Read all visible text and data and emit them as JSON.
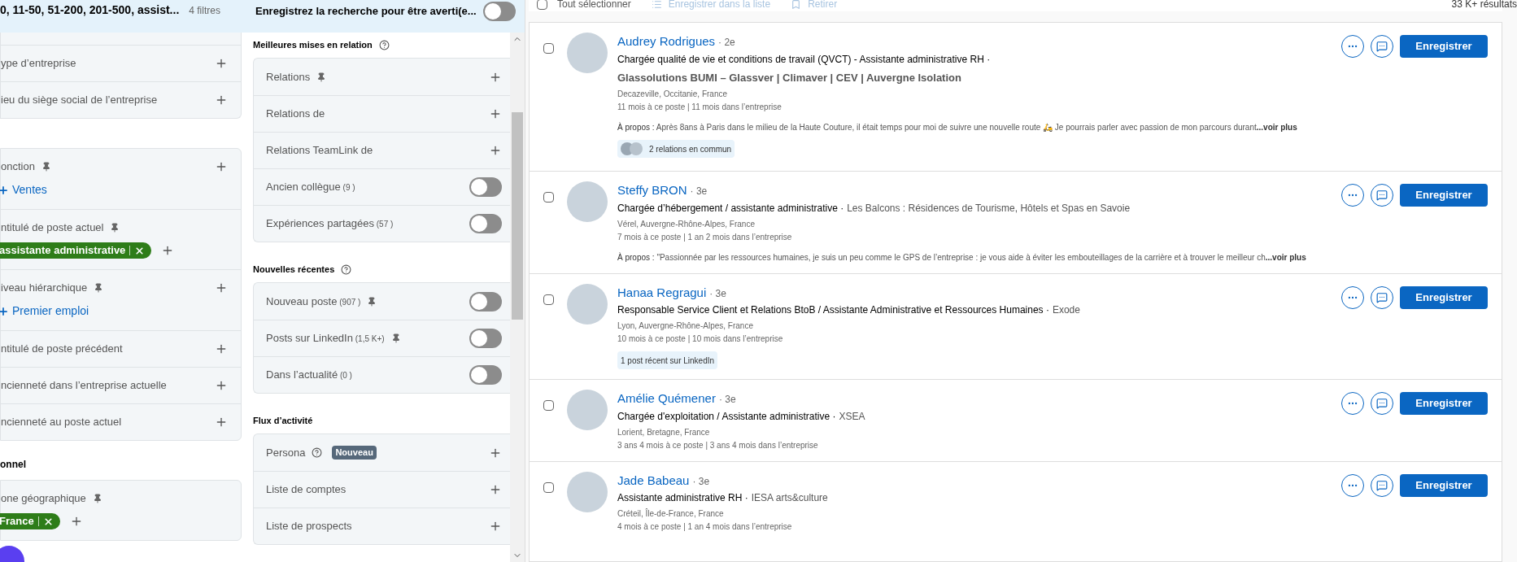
{
  "header": {
    "summary": "0, 11-50, 51-200, 201-500, assist...",
    "filter_count": "4 filtres",
    "save_search_label": "Enregistrez la recherche pour être averti(e...",
    "save_search_on": false
  },
  "left_groups": [
    {
      "cut_top": true,
      "items": [
        {
          "label": "ype d’entreprise"
        },
        {
          "label": "ieu du siège social de l’entreprise"
        }
      ]
    },
    {
      "items": [
        {
          "label": "onction",
          "pinned": true,
          "chips": [
            {
              "kind": "suggestion",
              "label": "Ventes"
            }
          ]
        },
        {
          "label": "ntitulé de poste actuel",
          "pinned": true,
          "chips": [
            {
              "kind": "included",
              "label": "assistante administrative"
            }
          ]
        },
        {
          "label": "iveau hiérarchique",
          "pinned": true,
          "chips": [
            {
              "kind": "suggestion",
              "label": "Premier emploi"
            }
          ]
        },
        {
          "label": "ntitulé de poste précédent"
        },
        {
          "label": "ncienneté dans l’entreprise actuelle"
        },
        {
          "label": "ncienneté au poste actuel"
        }
      ]
    },
    {
      "heading": "onnel",
      "items": [
        {
          "label": "one géographique",
          "pinned": true,
          "chips": [
            {
              "kind": "included",
              "label": "France"
            }
          ]
        }
      ]
    }
  ],
  "middle_groups": [
    {
      "heading": "Meilleures mises en relation",
      "help": true,
      "items": [
        {
          "kind": "add",
          "label": "Relations",
          "pinned": true
        },
        {
          "kind": "add",
          "label": "Relations de"
        },
        {
          "kind": "add",
          "label": "Relations TeamLink de"
        },
        {
          "kind": "toggle",
          "label": "Ancien collègue",
          "count": "(9 )",
          "on": false
        },
        {
          "kind": "toggle",
          "label": "Expériences partagées",
          "count": "(57 )",
          "on": false
        }
      ]
    },
    {
      "heading": "Nouvelles récentes",
      "help": true,
      "items": [
        {
          "kind": "toggle",
          "label": "Nouveau poste",
          "count": "(907 )",
          "pinned": true,
          "on": false
        },
        {
          "kind": "toggle",
          "label": "Posts sur LinkedIn",
          "count": "(1,5 K+)",
          "pinned": true,
          "on": false
        },
        {
          "kind": "toggle",
          "label": "Dans l’actualité",
          "count": "(0 )",
          "on": false
        }
      ]
    },
    {
      "heading": "Flux d’activité",
      "items": [
        {
          "kind": "add",
          "label": "Persona",
          "help": true,
          "badge": "Nouveau"
        },
        {
          "kind": "add",
          "label": "Liste de comptes"
        },
        {
          "kind": "add",
          "label": "Liste de prospects"
        }
      ]
    }
  ],
  "toolbar": {
    "select_all": "Tout sélectionner",
    "select_all_checked": false,
    "save_to_list": "Enregistrer dans la liste",
    "remove": "Retirer",
    "results": "33 K+ résultats"
  },
  "results": [
    {
      "name": "Audrey Rodrigues",
      "degree": "· 2e",
      "title": "Chargée qualité de vie et conditions de travail (QVCT) - Assistante administrative RH ·",
      "company": "Glassolutions BUMI – Glassver | Climaver | CEV | Auvergne Isolation",
      "location": "Decazeville, Occitanie, France",
      "tenure": "11 mois à ce poste | 11 mois dans l’entreprise",
      "about_label": "À propos :",
      "about": "Après 8ans à Paris dans le milieu de la Haute Couture, il était temps pour moi de suivre une nouvelle route 🛵 Je pourrais parler avec passion de mon parcours durant",
      "more": "...voir plus",
      "insight": {
        "kind": "relations",
        "label": "2 relations en commun"
      },
      "checked": false,
      "save": "Enregistrer"
    },
    {
      "name": "Steffy BRON",
      "degree": "· 3e",
      "title": "Chargée d’hébergement / assistante administrative ·",
      "company": "Les Balcons : Résidences de Tourisme, Hôtels et Spas en Savoie",
      "location": "Vérel, Auvergne-Rhône-Alpes, France",
      "tenure": "7 mois à ce poste | 1 an 2 mois dans l’entreprise",
      "about_label": "À propos :",
      "about": "\"Passionnée par les ressources humaines, je suis un peu comme le GPS de l’entreprise : je vous aide à éviter les embouteillages de la carrière et à trouver le meilleur ch",
      "more": "...voir plus",
      "checked": false,
      "save": "Enregistrer"
    },
    {
      "name": "Hanaa Regragui",
      "degree": "· 3e",
      "title": "Responsable Service Client et Relations BtoB / Assistante Administrative et Ressources Humaines ·",
      "company": "Exode",
      "location": "Lyon, Auvergne-Rhône-Alpes, France",
      "tenure": "10 mois à ce poste | 10 mois dans l’entreprise",
      "insight": {
        "kind": "post",
        "label": "1 post récent sur LinkedIn"
      },
      "checked": false,
      "save": "Enregistrer"
    },
    {
      "name": "Amélie Quémener",
      "degree": "· 3e",
      "title": "Chargée d'exploitation / Assistante administrative ·",
      "company": "XSEA",
      "location": "Lorient, Bretagne, France",
      "tenure": "3 ans 4 mois à ce poste | 3 ans 4 mois dans l’entreprise",
      "checked": false,
      "save": "Enregistrer"
    },
    {
      "name": "Jade Babeau",
      "degree": "· 3e",
      "title": "Assistante administrative RH ·",
      "company": "IESA arts&culture",
      "location": "Créteil, Île-de-France, France",
      "tenure": "4 mois à ce poste | 1 an 4 mois dans l’entreprise",
      "checked": false,
      "save": "Enregistrer"
    }
  ]
}
